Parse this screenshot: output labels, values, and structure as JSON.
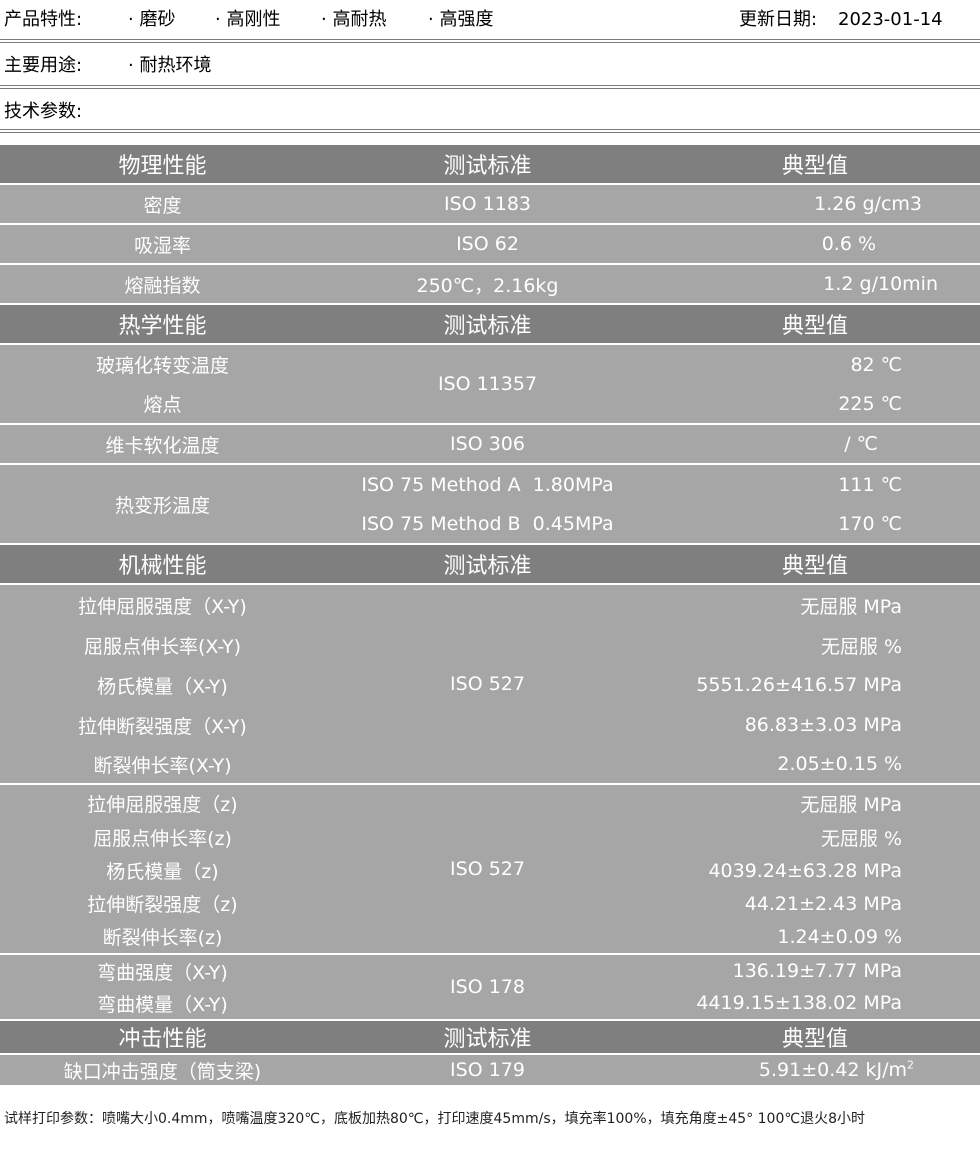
{
  "features": {
    "label": "产品特性:",
    "items": [
      "· 磨砂",
      "· 高刚性",
      "· 高耐热",
      "· 高强度"
    ],
    "update_label": "更新日期:",
    "update_date": "2023-01-14"
  },
  "usage": {
    "label": "主要用途:",
    "items": [
      "· 耐热环境"
    ]
  },
  "tech": {
    "label": "技术参数:"
  },
  "sections": {
    "physical": {
      "header": [
        "物理性能",
        "测试标准",
        "典型值"
      ],
      "rows": [
        {
          "name": "密度",
          "standard": "ISO 1183",
          "value": "1.26 g/cm3"
        },
        {
          "name": "吸湿率",
          "standard": "ISO 62",
          "value": "0.6 %"
        },
        {
          "name": "熔融指数",
          "standard": "250℃，2.16kg",
          "value": "1.2 g/10min"
        }
      ]
    },
    "thermal": {
      "header": [
        "热学性能",
        "测试标准",
        "典型值"
      ],
      "group1": {
        "names": [
          "玻璃化转变温度",
          "熔点"
        ],
        "standard": "ISO 11357",
        "values": [
          "82 ℃",
          "225 ℃"
        ]
      },
      "vicat": {
        "name": "维卡软化温度",
        "standard": "ISO 306",
        "value": "/ ℃"
      },
      "hdt": {
        "name": "热变形温度",
        "standards": [
          "ISO 75 Method A  1.80MPa",
          "ISO 75 Method B  0.45MPa"
        ],
        "values": [
          "111 ℃",
          "170 ℃"
        ]
      }
    },
    "mechanical": {
      "header": [
        "机械性能",
        "测试标准",
        "典型值"
      ],
      "xy": {
        "standard": "ISO 527",
        "names": [
          "拉伸屈服强度（X-Y)",
          "屈服点伸长率(X-Y)",
          "杨氏模量（X-Y)",
          "拉伸断裂强度（X-Y)",
          "断裂伸长率(X-Y)"
        ],
        "values": [
          "无屈服 MPa",
          "无屈服 %",
          "5551.26±416.57 MPa",
          "86.83±3.03 MPa",
          "2.05±0.15 %"
        ]
      },
      "z": {
        "standard": "ISO 527",
        "names": [
          "拉伸屈服强度（z)",
          "屈服点伸长率(z)",
          "杨氏模量（z)",
          "拉伸断裂强度（z)",
          "断裂伸长率(z)"
        ],
        "values": [
          "无屈服 MPa",
          "无屈服 %",
          "4039.24±63.28 MPa",
          "44.21±2.43 MPa",
          "1.24±0.09 %"
        ]
      },
      "flex": {
        "standard": "ISO 178",
        "names": [
          "弯曲强度（X-Y)",
          "弯曲模量（X-Y)"
        ],
        "values": [
          "136.19±7.77 MPa",
          "4419.15±138.02 MPa"
        ]
      }
    },
    "impact": {
      "header": [
        "冲击性能",
        "测试标准",
        "典型值"
      ],
      "row": {
        "name": "缺口冲击强度（筒支梁)",
        "standard": "ISO 179",
        "value": "5.91±0.42 kJ/m",
        "value_sup": "2"
      }
    }
  },
  "footer": "试样打印参数：喷嘴大小0.4mm，喷嘴温度320℃，底板加热80℃，打印速度45mm/s，填充率100%，填充角度±45°   100℃退火8小时"
}
